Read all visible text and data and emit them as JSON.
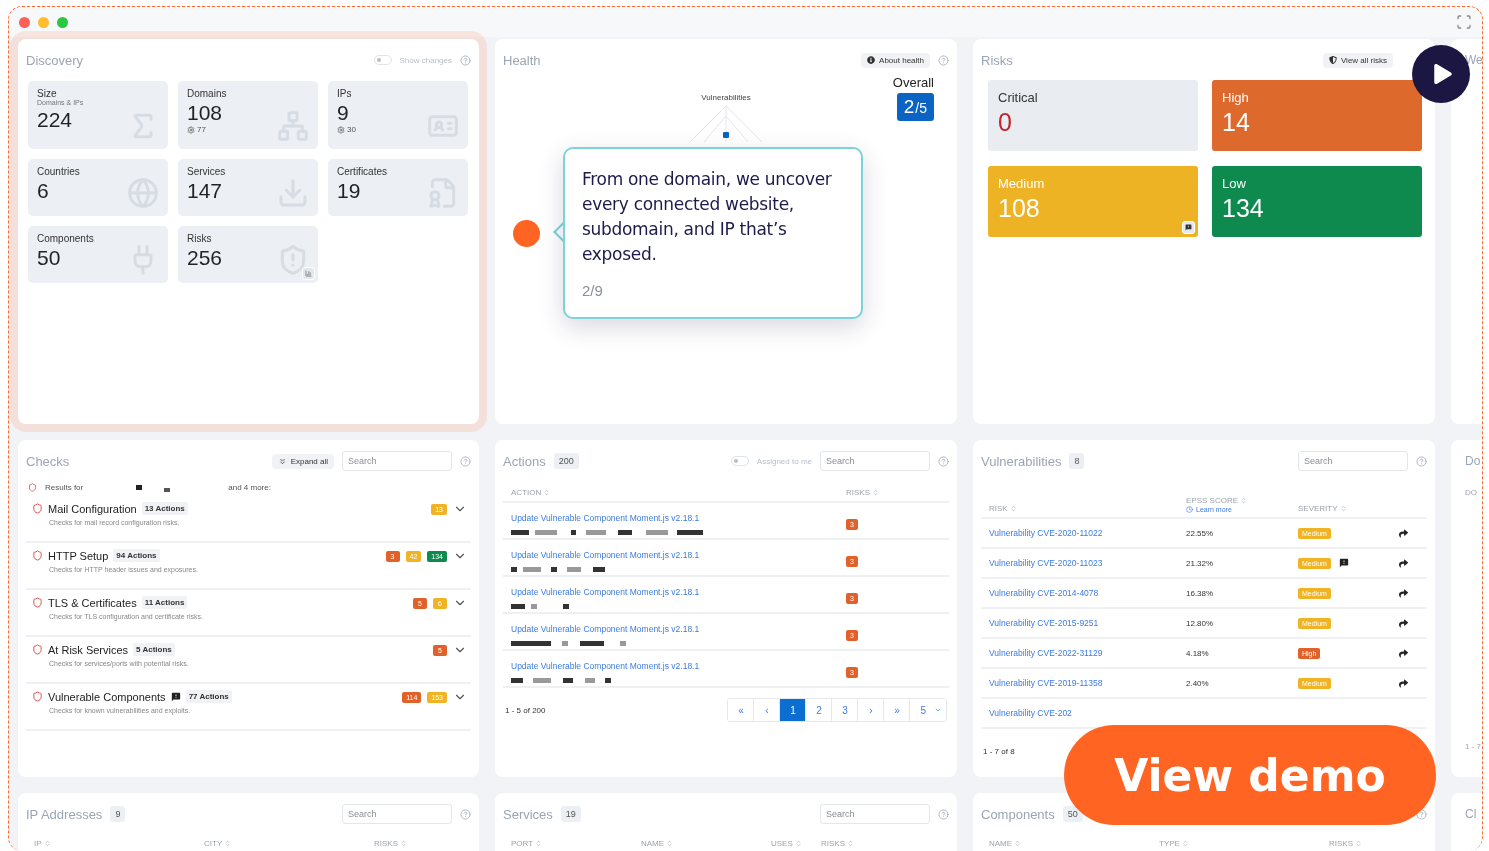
{
  "discovery": {
    "title": "Discovery",
    "toggle": {
      "label": "Show changes",
      "on": false
    },
    "tiles": [
      {
        "label": "Size",
        "sublabel": "Domains & IPs",
        "value": "224",
        "corner_button": false
      },
      {
        "label": "Domains",
        "value": "108",
        "extra": "77",
        "corner_button": false
      },
      {
        "label": "IPs",
        "value": "9",
        "extra": "30",
        "corner_button": false
      },
      {
        "label": "Countries",
        "value": "6",
        "corner_button": false
      },
      {
        "label": "Services",
        "value": "147",
        "corner_button": false
      },
      {
        "label": "Certificates",
        "value": "19",
        "corner_button": false
      },
      {
        "label": "Components",
        "value": "50",
        "corner_button": false
      },
      {
        "label": "Risks",
        "value": "256",
        "corner_button": true
      }
    ]
  },
  "health": {
    "title": "Health",
    "about_button": "About health",
    "overall_label": "Overall",
    "score": "2",
    "score_of": "/5",
    "radar_label": "Vulnerabilities",
    "tooltip": {
      "text": "From one domain, we uncover every connected website, subdomain, and IP that’s exposed.",
      "step": "2/9"
    }
  },
  "risks": {
    "title": "Risks",
    "button": "View all risks",
    "tiles": [
      {
        "label": "Critical",
        "value": "0",
        "kind": "plain",
        "color": "#c0282d",
        "corner_button": false
      },
      {
        "label": "High",
        "value": "14",
        "kind": "filled",
        "color": "#dd6a2c",
        "corner_button": false
      },
      {
        "label": "Medium",
        "value": "108",
        "kind": "filled",
        "color": "#eeb325",
        "corner_button": true
      },
      {
        "label": "Low",
        "value": "134",
        "kind": "filled",
        "color": "#0f8a4f",
        "corner_button": false
      }
    ]
  },
  "checks": {
    "title": "Checks",
    "expand_button": "Expand all",
    "search_placeholder": "Search",
    "results": {
      "prefix": "Results for",
      "suffix": "and 4 more:"
    },
    "items": [
      {
        "title": "Mail Configuration",
        "actions": "13 Actions",
        "description": "Checks for mail record configuration risks.",
        "note_icon": false,
        "counts": [
          {
            "value": "13",
            "color": "#f0b323"
          }
        ]
      },
      {
        "title": "HTTP Setup",
        "actions": "94 Actions",
        "description": "Checks for HTTP header issues and exposures.",
        "note_icon": false,
        "counts": [
          {
            "value": "3",
            "color": "#e0622a"
          },
          {
            "value": "42",
            "color": "#f0b323"
          },
          {
            "value": "134",
            "color": "#0f8a4f"
          }
        ]
      },
      {
        "title": "TLS & Certificates",
        "actions": "11 Actions",
        "description": "Checks for TLS configuration and certificate risks.",
        "note_icon": false,
        "counts": [
          {
            "value": "5",
            "color": "#e0622a"
          },
          {
            "value": "6",
            "color": "#f0b323"
          }
        ]
      },
      {
        "title": "At Risk Services",
        "actions": "5 Actions",
        "description": "Checks for services/ports with potential risks.",
        "note_icon": false,
        "counts": [
          {
            "value": "5",
            "color": "#e0622a"
          }
        ]
      },
      {
        "title": "Vulnerable Components",
        "actions": "77 Actions",
        "description": "Checks for known vulnerabilities and exploits.",
        "note_icon": true,
        "counts": [
          {
            "value": "114",
            "color": "#e0622a"
          },
          {
            "value": "153",
            "color": "#f0b323"
          }
        ]
      }
    ]
  },
  "actions": {
    "title": "Actions",
    "count": "200",
    "toggle": {
      "label": "Assigned to me",
      "on": false
    },
    "search_placeholder": "Search",
    "columns": [
      "ACTION",
      "RISKS"
    ],
    "rows": [
      {
        "title": "Update Vulnerable Component Moment.js v2.18.1",
        "risks": "3"
      },
      {
        "title": "Update Vulnerable Component Moment.js v2.18.1",
        "risks": "3"
      },
      {
        "title": "Update Vulnerable Component Moment.js v2.18.1",
        "risks": "3"
      },
      {
        "title": "Update Vulnerable Component Moment.js v2.18.1",
        "risks": "3"
      },
      {
        "title": "Update Vulnerable Component Moment.js v2.18.1",
        "risks": "3"
      }
    ],
    "range": "1 - 5 of 200",
    "pages": [
      {
        "label": "«",
        "selected": false
      },
      {
        "label": "‹",
        "selected": false
      },
      {
        "label": "1",
        "selected": true
      },
      {
        "label": "2",
        "selected": false
      },
      {
        "label": "3",
        "selected": false
      },
      {
        "label": "›",
        "selected": false
      },
      {
        "label": "»",
        "selected": false
      }
    ],
    "page_size": "5"
  },
  "vulnerabilities": {
    "title": "Vulnerabilities",
    "count": "8",
    "search_placeholder": "Search",
    "columns": [
      "RISK",
      "EPSS SCORE",
      "SEVERITY"
    ],
    "learn_more": "Learn more",
    "rows": [
      {
        "name": "Vulnerability CVE-2020-11022",
        "epss": "22.55%",
        "severity": "Medium",
        "color": "#f0b323",
        "note_icon": false
      },
      {
        "name": "Vulnerability CVE-2020-11023",
        "epss": "21.32%",
        "severity": "Medium",
        "color": "#f0b323",
        "note_icon": true
      },
      {
        "name": "Vulnerability CVE-2014-4078",
        "epss": "16.38%",
        "severity": "Medium",
        "color": "#f0b323",
        "note_icon": false
      },
      {
        "name": "Vulnerability CVE-2015-9251",
        "epss": "12.80%",
        "severity": "Medium",
        "color": "#f0b323",
        "note_icon": false
      },
      {
        "name": "Vulnerability CVE-2022-31129",
        "epss": "4.18%",
        "severity": "High",
        "color": "#e0622a",
        "note_icon": false
      },
      {
        "name": "Vulnerability CVE-2019-11358",
        "epss": "2.40%",
        "severity": "Medium",
        "color": "#f0b323",
        "note_icon": false
      },
      {
        "name": "Vulnerability CVE-202"
      }
    ],
    "range": "1 - 7 of 8"
  },
  "bottom_panels": [
    {
      "title": "IP Addresses",
      "count": "9",
      "search_placeholder": "Search",
      "columns": [
        "IP",
        "CITY",
        "RISKS"
      ]
    },
    {
      "title": "Services",
      "count": "19",
      "search_placeholder": "Search",
      "columns": [
        "PORT",
        "NAME",
        "USES",
        "RISKS"
      ]
    },
    {
      "title": "Components",
      "count": "50",
      "columns": [
        "NAME",
        "TYPE",
        "RISKS"
      ]
    }
  ],
  "side_panels": [
    {
      "title": "We"
    },
    {
      "title": "Do",
      "header": "DO",
      "footer": "1 - 7"
    },
    {
      "title": "Cl"
    }
  ],
  "view_demo_button": "View demo"
}
